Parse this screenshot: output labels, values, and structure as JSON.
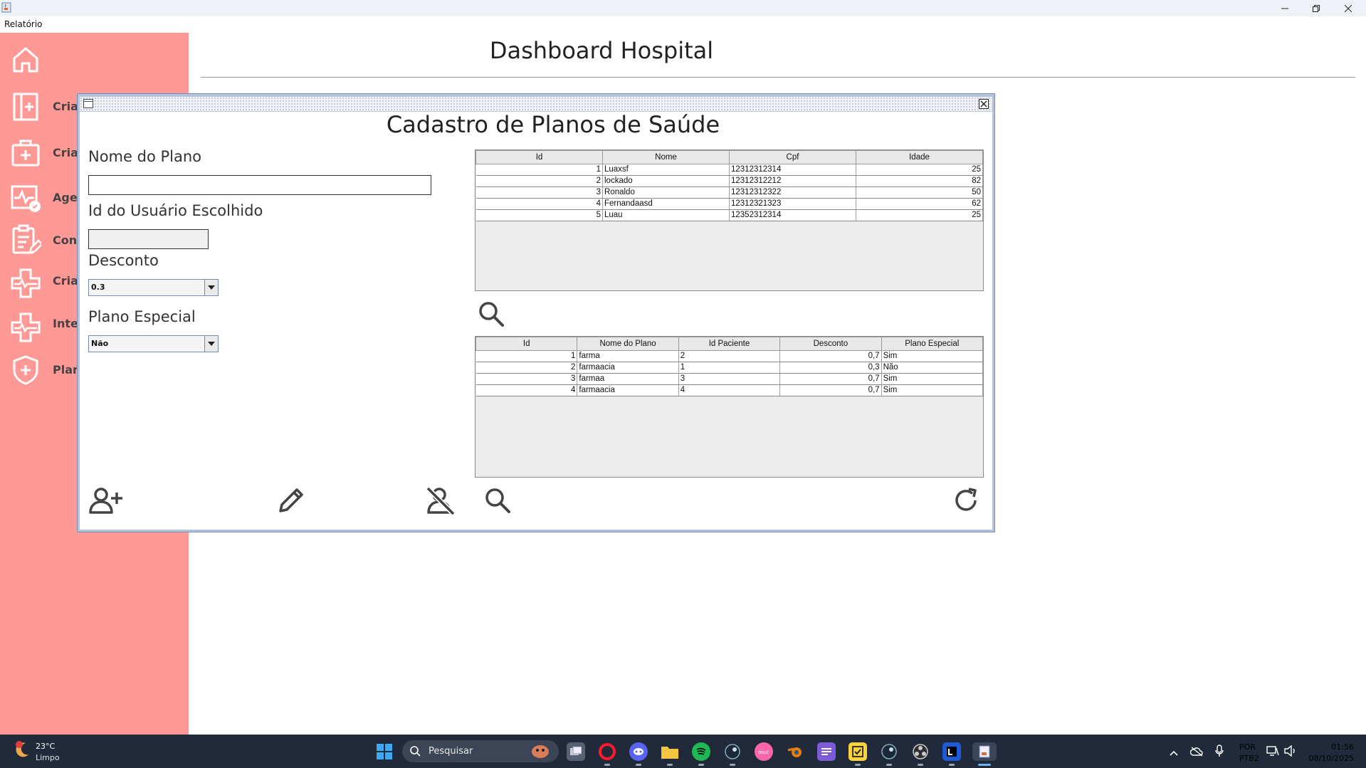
{
  "window": {
    "app_icon": "java-cup-icon",
    "controls": [
      "minimize-icon",
      "restore-icon",
      "close-icon"
    ]
  },
  "menubar": {
    "items": [
      "Relatório"
    ]
  },
  "sidebar": {
    "items": [
      {
        "icon": "home-icon",
        "label": ""
      },
      {
        "icon": "hospital-building-icon",
        "label": "Criaç"
      },
      {
        "icon": "medical-kit-icon",
        "label": "Criaç"
      },
      {
        "icon": "heart-monitor-icon",
        "label": "Agen"
      },
      {
        "icon": "clipboard-edit-icon",
        "label": "Con"
      },
      {
        "icon": "cross-pulse-icon",
        "label": "Cria"
      },
      {
        "icon": "cross-pulse-icon",
        "label": "Inte"
      },
      {
        "icon": "shield-plus-icon",
        "label": "Plan"
      }
    ],
    "color": "#ff9996"
  },
  "main": {
    "title": "Dashboard Hospital"
  },
  "form": {
    "title": "Cadastro de Planos de Saúde",
    "nome_label": "Nome do Plano",
    "nome_value": "",
    "id_label": "Id do Usuário Escolhido",
    "id_value": "",
    "desconto_label": "Desconto",
    "desconto_value": "0.3",
    "especial_label": "Plano Especial",
    "especial_value": "Não"
  },
  "users_table": {
    "columns": [
      "Id",
      "Nome",
      "Cpf",
      "Idade"
    ],
    "rows": [
      [
        "1",
        "Luaxsf",
        "12312312314",
        "25"
      ],
      [
        "2",
        "lockado",
        "12312312212",
        "82"
      ],
      [
        "3",
        "Ronaldo",
        "12312312322",
        "50"
      ],
      [
        "4",
        "Fernandaasd",
        "12312321323",
        "62"
      ],
      [
        "5",
        "Luau",
        "12352312314",
        "25"
      ]
    ]
  },
  "plans_table": {
    "columns": [
      "Id",
      "Nome do Plano",
      "Id Paciente",
      "Desconto",
      "Plano Especial"
    ],
    "rows": [
      [
        "1",
        "farma",
        "2",
        "0,7",
        "Sim"
      ],
      [
        "2",
        "farmaacia",
        "1",
        "0,3",
        "Não"
      ],
      [
        "3",
        "farmaa",
        "3",
        "0,7",
        "Sim"
      ],
      [
        "4",
        "farmaacia",
        "4",
        "0,7",
        "Sim"
      ]
    ]
  },
  "actions": [
    "add-user-icon",
    "edit-pencil-icon",
    "remove-user-icon",
    "search-icon",
    "refresh-icon"
  ],
  "taskbar": {
    "weather_temp": "23°C",
    "weather_desc": "Limpo",
    "search_placeholder": "Pesquisar",
    "lang_line1": "POR",
    "lang_line2": "PTB2",
    "time": "01:56",
    "date": "08/10/2025",
    "accent": "#202a3a"
  }
}
